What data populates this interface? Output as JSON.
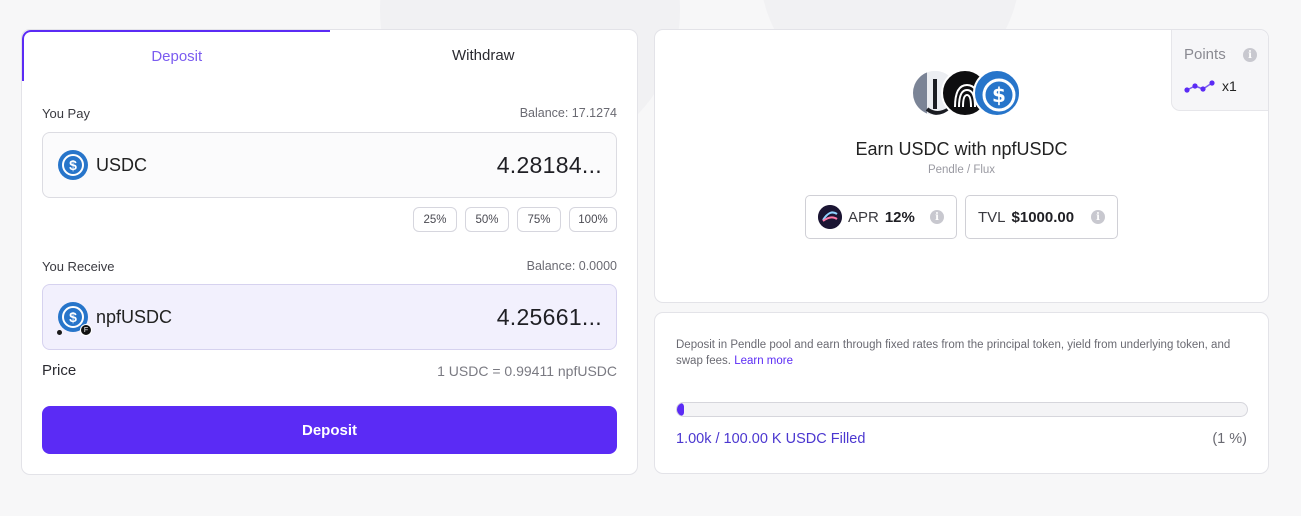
{
  "tabs": {
    "deposit": "Deposit",
    "withdraw": "Withdraw",
    "active": "Deposit"
  },
  "pay": {
    "label": "You Pay",
    "balance": "Balance: 17.1274",
    "token": "USDC",
    "amount": "4.28184..."
  },
  "percent_options": [
    "25%",
    "50%",
    "75%",
    "100%"
  ],
  "receive": {
    "label": "You Receive",
    "balance": "Balance: 0.0000",
    "token": "npfUSDC",
    "amount": "4.25661..."
  },
  "price": {
    "label": "Price",
    "value": "1 USDC = 0.99411 npfUSDC"
  },
  "deposit_button": "Deposit",
  "points": {
    "title": "Points",
    "value": "x1"
  },
  "vault": {
    "title": "Earn USDC with npfUSDC",
    "subtitle": "Pendle / Flux",
    "apr_label": "APR",
    "apr_value": "12%",
    "tvl_label": "TVL",
    "tvl_value": "$1000.00"
  },
  "info": {
    "description": "Deposit in Pendle pool and earn through fixed rates from the principal token, yield from underlying token, and swap fees.",
    "learn_more": "Learn more",
    "filled_text": "1.00k / 100.00 K USDC Filled",
    "filled_percent": "(1 %)",
    "progress_fraction": 0.01
  },
  "colors": {
    "accent": "#5b2bf5",
    "usdc": "#2775ca",
    "background": "#f7f7f8"
  },
  "icons": {
    "usdc": "usdc-coin-icon",
    "info": "info-icon",
    "points": "points-glyph-icon",
    "pendle": "pendle-icon"
  }
}
